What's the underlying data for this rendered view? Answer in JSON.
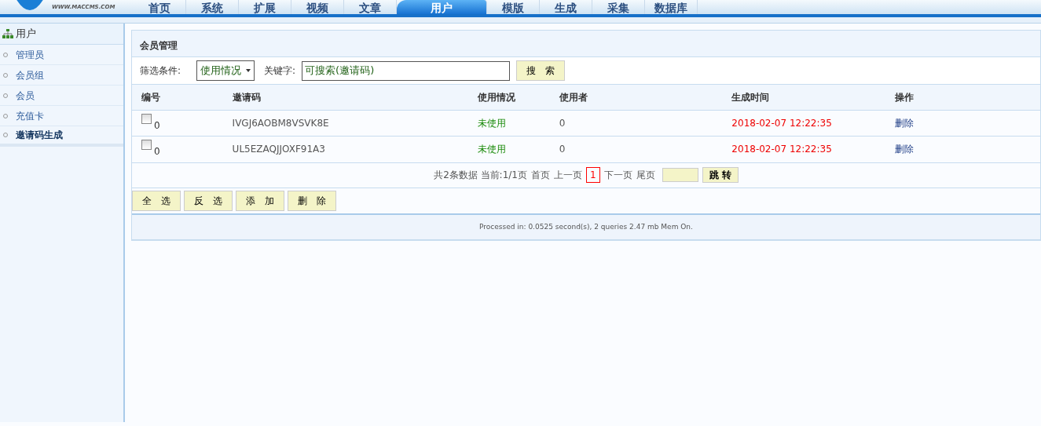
{
  "logo": {
    "url": "WWW.MACCMS.COM"
  },
  "nav": [
    {
      "label": "首页",
      "selected": false
    },
    {
      "label": "系统",
      "selected": false
    },
    {
      "label": "扩展",
      "selected": false
    },
    {
      "label": "视频",
      "selected": false
    },
    {
      "label": "文章",
      "selected": false
    },
    {
      "label": "用户",
      "selected": true
    },
    {
      "label": "模版",
      "selected": false
    },
    {
      "label": "生成",
      "selected": false
    },
    {
      "label": "采集",
      "selected": false
    },
    {
      "label": "数据库",
      "selected": false
    }
  ],
  "sidebar": {
    "title": "用户",
    "items": [
      {
        "label": "管理员",
        "selected": false
      },
      {
        "label": "会员组",
        "selected": false
      },
      {
        "label": "会员",
        "selected": false
      },
      {
        "label": "充值卡",
        "selected": false
      },
      {
        "label": "邀请码生成",
        "selected": true
      }
    ]
  },
  "panel": {
    "title": "会员管理",
    "filter_label": "筛选条件:",
    "filter_value": "使用情况",
    "keyword_label": "关键字:",
    "keyword_value": "可搜索(邀请码)",
    "search_button": "搜　索"
  },
  "table": {
    "columns": [
      "编号",
      "邀请码",
      "使用情况",
      "使用者",
      "生成时间",
      "操作"
    ],
    "rows": [
      {
        "checked": false,
        "id": "0",
        "code": "IVGJ6AOBM8VSVK8E",
        "usage": "未使用",
        "user": "0",
        "time": "2018-02-07 12:22:35",
        "action": "删除"
      },
      {
        "checked": false,
        "id": "0",
        "code": "UL5EZAQJJOXF91A3",
        "usage": "未使用",
        "user": "0",
        "time": "2018-02-07 12:22:35",
        "action": "删除"
      }
    ]
  },
  "pager": {
    "summary": "共2条数据 当前:1/1页",
    "first": "首页",
    "prev": "上一页",
    "current": "1",
    "next": "下一页",
    "last": "尾页",
    "go_button": "跳 转"
  },
  "buttons": [
    "全　选",
    "反　选",
    "添　加",
    "删　除"
  ],
  "footer": "Processed in: 0.0525 second(s), 2 queries 2.47 mb Mem On."
}
